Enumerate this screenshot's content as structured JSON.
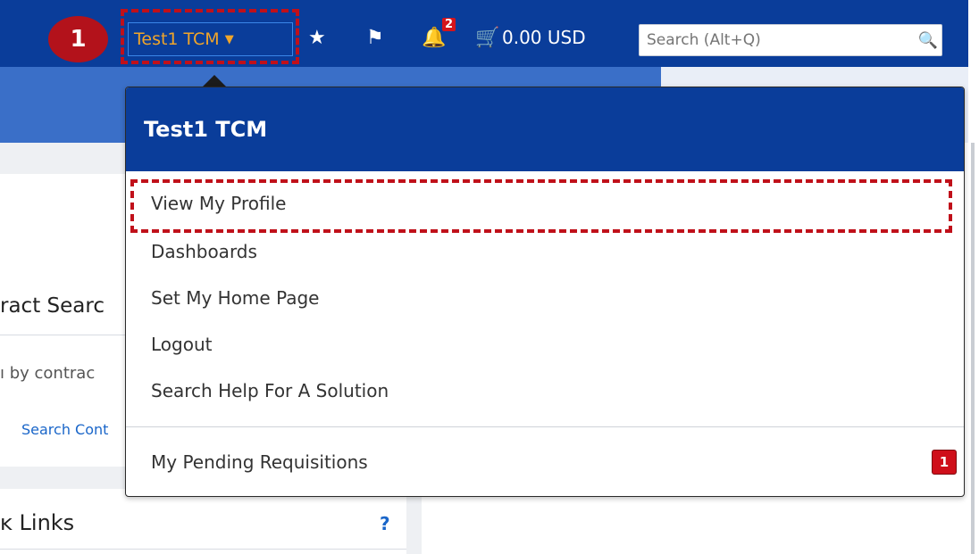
{
  "step_badge": "1",
  "user_menu": {
    "label": "Test1 TCM"
  },
  "topbar": {
    "star_icon": "★",
    "flag_icon": "⚑",
    "bell_icon": "🔔",
    "notifications_count": "2",
    "cart_icon": "🛒",
    "cart_total": "0.00 USD",
    "search_placeholder": "Search (Alt+Q)",
    "search_icon": "🔍"
  },
  "dropdown": {
    "header": "Test1 TCM",
    "items": [
      "View My Profile",
      "Dashboards",
      "Set My Home Page",
      "Logout",
      "Search Help For A Solution"
    ],
    "pending": {
      "label": "My Pending Requisitions",
      "count": "1"
    }
  },
  "left": {
    "contract_title": "ract Searc",
    "contract_input_text": "ı by contrac",
    "contract_link": "Search Cont",
    "quick_links_title": "ĸ Links",
    "quick_links_help": "?"
  }
}
